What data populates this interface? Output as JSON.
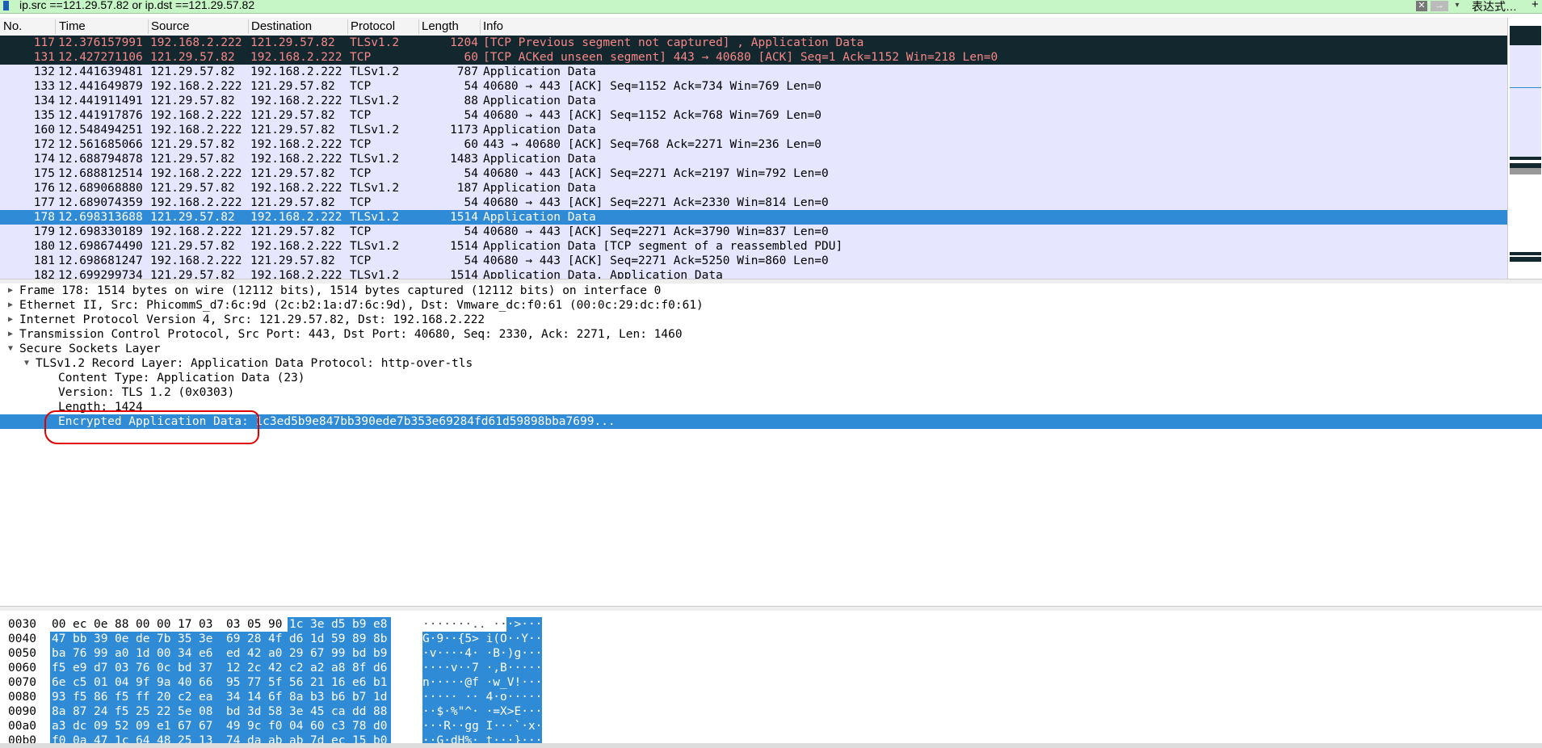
{
  "filter": {
    "value": "ip.src ==121.29.57.82  or ip.dst ==121.29.57.82",
    "clear_label": "✕",
    "apply_label": "→",
    "dropdown_label": "▾",
    "expression_label": "表达式…",
    "add_label": "+"
  },
  "packet_list": {
    "columns": [
      "No.",
      "Time",
      "Source",
      "Destination",
      "Protocol",
      "Length",
      "Info"
    ],
    "rows": [
      {
        "no": "117",
        "time": "12.376157991",
        "src": "192.168.2.222",
        "dst": "121.29.57.82",
        "proto": "TLSv1.2",
        "len": "1204",
        "info": "[TCP Previous segment not captured] , Application Data",
        "state": "err"
      },
      {
        "no": "131",
        "time": "12.427271106",
        "src": "121.29.57.82",
        "dst": "192.168.2.222",
        "proto": "TCP",
        "len": "60",
        "info": "[TCP ACKed unseen segment] 443 → 40680 [ACK] Seq=1 Ack=1152 Win=218 Len=0",
        "state": "err"
      },
      {
        "no": "132",
        "time": "12.441639481",
        "src": "121.29.57.82",
        "dst": "192.168.2.222",
        "proto": "TLSv1.2",
        "len": "787",
        "info": "Application Data",
        "state": ""
      },
      {
        "no": "133",
        "time": "12.441649879",
        "src": "192.168.2.222",
        "dst": "121.29.57.82",
        "proto": "TCP",
        "len": "54",
        "info": "40680 → 443 [ACK] Seq=1152 Ack=734 Win=769 Len=0",
        "state": ""
      },
      {
        "no": "134",
        "time": "12.441911491",
        "src": "121.29.57.82",
        "dst": "192.168.2.222",
        "proto": "TLSv1.2",
        "len": "88",
        "info": "Application Data",
        "state": ""
      },
      {
        "no": "135",
        "time": "12.441917876",
        "src": "192.168.2.222",
        "dst": "121.29.57.82",
        "proto": "TCP",
        "len": "54",
        "info": "40680 → 443 [ACK] Seq=1152 Ack=768 Win=769 Len=0",
        "state": ""
      },
      {
        "no": "160",
        "time": "12.548494251",
        "src": "192.168.2.222",
        "dst": "121.29.57.82",
        "proto": "TLSv1.2",
        "len": "1173",
        "info": "Application Data",
        "state": ""
      },
      {
        "no": "172",
        "time": "12.561685066",
        "src": "121.29.57.82",
        "dst": "192.168.2.222",
        "proto": "TCP",
        "len": "60",
        "info": "443 → 40680 [ACK] Seq=768 Ack=2271 Win=236 Len=0",
        "state": ""
      },
      {
        "no": "174",
        "time": "12.688794878",
        "src": "121.29.57.82",
        "dst": "192.168.2.222",
        "proto": "TLSv1.2",
        "len": "1483",
        "info": "Application Data",
        "state": ""
      },
      {
        "no": "175",
        "time": "12.688812514",
        "src": "192.168.2.222",
        "dst": "121.29.57.82",
        "proto": "TCP",
        "len": "54",
        "info": "40680 → 443 [ACK] Seq=2271 Ack=2197 Win=792 Len=0",
        "state": ""
      },
      {
        "no": "176",
        "time": "12.689068880",
        "src": "121.29.57.82",
        "dst": "192.168.2.222",
        "proto": "TLSv1.2",
        "len": "187",
        "info": "Application Data",
        "state": ""
      },
      {
        "no": "177",
        "time": "12.689074359",
        "src": "192.168.2.222",
        "dst": "121.29.57.82",
        "proto": "TCP",
        "len": "54",
        "info": "40680 → 443 [ACK] Seq=2271 Ack=2330 Win=814 Len=0",
        "state": ""
      },
      {
        "no": "178",
        "time": "12.698313688",
        "src": "121.29.57.82",
        "dst": "192.168.2.222",
        "proto": "TLSv1.2",
        "len": "1514",
        "info": "Application Data",
        "state": "sel"
      },
      {
        "no": "179",
        "time": "12.698330189",
        "src": "192.168.2.222",
        "dst": "121.29.57.82",
        "proto": "TCP",
        "len": "54",
        "info": "40680 → 443 [ACK] Seq=2271 Ack=3790 Win=837 Len=0",
        "state": ""
      },
      {
        "no": "180",
        "time": "12.698674490",
        "src": "121.29.57.82",
        "dst": "192.168.2.222",
        "proto": "TLSv1.2",
        "len": "1514",
        "info": "Application Data [TCP segment of a reassembled PDU]",
        "state": ""
      },
      {
        "no": "181",
        "time": "12.698681247",
        "src": "192.168.2.222",
        "dst": "121.29.57.82",
        "proto": "TCP",
        "len": "54",
        "info": "40680 → 443 [ACK] Seq=2271 Ack=5250 Win=860 Len=0",
        "state": ""
      },
      {
        "no": "182",
        "time": "12.699299734",
        "src": "121.29.57.82",
        "dst": "192.168.2.222",
        "proto": "TLSv1.2",
        "len": "1514",
        "info": "Application Data, Application Data",
        "state": ""
      }
    ]
  },
  "details": {
    "rows": [
      {
        "text": "Frame 178: 1514 bytes on wire (12112 bits), 1514 bytes captured (12112 bits) on interface 0",
        "level": 0,
        "tri": "▶",
        "sel": false
      },
      {
        "text": "Ethernet II, Src: PhicommS_d7:6c:9d (2c:b2:1a:d7:6c:9d), Dst: Vmware_dc:f0:61 (00:0c:29:dc:f0:61)",
        "level": 0,
        "tri": "▶",
        "sel": false
      },
      {
        "text": "Internet Protocol Version 4, Src: 121.29.57.82, Dst: 192.168.2.222",
        "level": 0,
        "tri": "▶",
        "sel": false
      },
      {
        "text": "Transmission Control Protocol, Src Port: 443, Dst Port: 40680, Seq: 2330, Ack: 2271, Len: 1460",
        "level": 0,
        "tri": "▶",
        "sel": false
      },
      {
        "text": "Secure Sockets Layer",
        "level": 0,
        "tri": "▼",
        "sel": false
      },
      {
        "text": "TLSv1.2 Record Layer: Application Data Protocol: http-over-tls",
        "level": 1,
        "tri": "▼",
        "sel": false
      },
      {
        "text": "Content Type: Application Data (23)",
        "level": 2,
        "tri": "",
        "sel": false
      },
      {
        "text": "Version: TLS 1.2 (0x0303)",
        "level": 2,
        "tri": "",
        "sel": false
      },
      {
        "text": "Length: 1424",
        "level": 2,
        "tri": "",
        "sel": false
      },
      {
        "text": "Encrypted Application Data: 1c3ed5b9e847bb390ede7b353e69284fd61d59898bba7699...",
        "level": 2,
        "tri": "",
        "sel": true
      }
    ]
  },
  "bytes": {
    "rows": [
      {
        "offset": "0030",
        "hex": [
          "00",
          "ec",
          "0e",
          "88",
          "00",
          "00",
          "17",
          "03",
          "03",
          "05",
          "90",
          "1c",
          "3e",
          "d5",
          "b9",
          "e8"
        ],
        "ascii": "·······.. ···>···",
        "hl_from": 11,
        "ascii_hl_from": 11
      },
      {
        "offset": "0040",
        "hex": [
          "47",
          "bb",
          "39",
          "0e",
          "de",
          "7b",
          "35",
          "3e",
          "69",
          "28",
          "4f",
          "d6",
          "1d",
          "59",
          "89",
          "8b"
        ],
        "ascii": "G·9··{5> i(O··Y··",
        "hl_from": 0,
        "ascii_hl_from": 0
      },
      {
        "offset": "0050",
        "hex": [
          "ba",
          "76",
          "99",
          "a0",
          "1d",
          "00",
          "34",
          "e6",
          "ed",
          "42",
          "a0",
          "29",
          "67",
          "99",
          "bd",
          "b9"
        ],
        "ascii": "·v····4· ·B·)g···",
        "hl_from": 0,
        "ascii_hl_from": 0
      },
      {
        "offset": "0060",
        "hex": [
          "f5",
          "e9",
          "d7",
          "03",
          "76",
          "0c",
          "bd",
          "37",
          "12",
          "2c",
          "42",
          "c2",
          "a2",
          "a8",
          "8f",
          "d6"
        ],
        "ascii": "····v··7 ·,B·····",
        "hl_from": 0,
        "ascii_hl_from": 0
      },
      {
        "offset": "0070",
        "hex": [
          "6e",
          "c5",
          "01",
          "04",
          "9f",
          "9a",
          "40",
          "66",
          "95",
          "77",
          "5f",
          "56",
          "21",
          "16",
          "e6",
          "b1"
        ],
        "ascii": "n·····@f ·w_V!···",
        "hl_from": 0,
        "ascii_hl_from": 0
      },
      {
        "offset": "0080",
        "hex": [
          "93",
          "f5",
          "86",
          "f5",
          "ff",
          "20",
          "c2",
          "ea",
          "34",
          "14",
          "6f",
          "8a",
          "b3",
          "b6",
          "b7",
          "1d"
        ],
        "ascii": "····· ·· 4·o·····",
        "hl_from": 0,
        "ascii_hl_from": 0
      },
      {
        "offset": "0090",
        "hex": [
          "8a",
          "87",
          "24",
          "f5",
          "25",
          "22",
          "5e",
          "08",
          "bd",
          "3d",
          "58",
          "3e",
          "45",
          "ca",
          "dd",
          "88"
        ],
        "ascii": "··$·%\"^· ·=X>E···",
        "hl_from": 0,
        "ascii_hl_from": 0
      },
      {
        "offset": "00a0",
        "hex": [
          "a3",
          "dc",
          "09",
          "52",
          "09",
          "e1",
          "67",
          "67",
          "49",
          "9c",
          "f0",
          "04",
          "60",
          "c3",
          "78",
          "d0"
        ],
        "ascii": "···R··gg I···`·x·",
        "hl_from": 0,
        "ascii_hl_from": 0
      },
      {
        "offset": "00b0",
        "hex": [
          "f0",
          "0a",
          "47",
          "1c",
          "64",
          "48",
          "25",
          "13",
          "74",
          "da",
          "ab",
          "ab",
          "7d",
          "ec",
          "15",
          "b0"
        ],
        "ascii": "··G·dH%· t···}···",
        "hl_from": 0,
        "ascii_hl_from": 0
      }
    ]
  },
  "colors": {
    "filter_bg": "#c6f5c6",
    "row_bg": "#e7e6ff",
    "error_bg": "#12272e",
    "error_fg": "#f78787",
    "selection": "#2f8bd6",
    "annotation": "#e00000"
  }
}
